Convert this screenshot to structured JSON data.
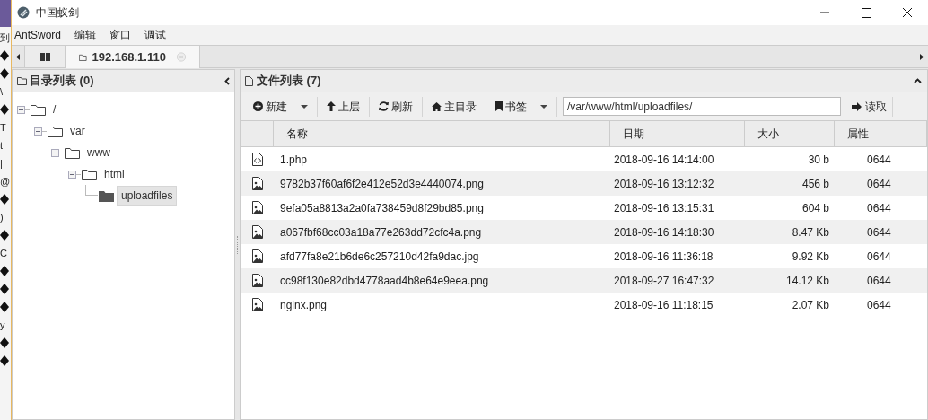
{
  "background_fragments": [
    {
      "kind": "text",
      "text": "到"
    },
    {
      "kind": "unknown_glyph"
    },
    {
      "kind": "unknown_glyph"
    },
    {
      "kind": "text",
      "text": "\\"
    },
    {
      "kind": "unknown_glyph"
    },
    {
      "kind": "text",
      "text": "T"
    },
    {
      "kind": "text",
      "text": "t"
    },
    {
      "kind": "text",
      "text": "|"
    },
    {
      "kind": "text",
      "text": "@"
    },
    {
      "kind": "unknown_glyph"
    },
    {
      "kind": "text",
      "text": ")"
    },
    {
      "kind": "unknown_glyph"
    },
    {
      "kind": "text",
      "text": "C"
    },
    {
      "kind": "unknown_glyph"
    },
    {
      "kind": "unknown_glyph"
    },
    {
      "kind": "unknown_glyph"
    },
    {
      "kind": "text",
      "text": "y"
    },
    {
      "kind": "unknown_glyph"
    },
    {
      "kind": "unknown_glyph"
    }
  ],
  "window": {
    "title": "中国蚁剑"
  },
  "menu": [
    "AntSword",
    "编辑",
    "窗口",
    "调试"
  ],
  "tabs": [
    {
      "label": "192.168.1.110",
      "selected": true
    }
  ],
  "dir_panel": {
    "title": "目录列表 (0)",
    "tree": [
      {
        "name": "/",
        "selected": false,
        "children": [
          {
            "name": "var",
            "selected": false,
            "children": [
              {
                "name": "www",
                "selected": false,
                "children": [
                  {
                    "name": "html",
                    "selected": false,
                    "children": [
                      {
                        "name": "uploadfiles",
                        "selected": true
                      }
                    ]
                  }
                ]
              }
            ]
          }
        ]
      }
    ]
  },
  "file_panel": {
    "title": "文件列表 (7)",
    "toolbar": [
      {
        "label": "新建",
        "dropdown": true
      },
      {
        "label": "上层",
        "dropdown": false
      },
      {
        "label": "刷新",
        "dropdown": false
      },
      {
        "label": "主目录",
        "dropdown": false
      },
      {
        "label": "书签",
        "dropdown": true
      }
    ],
    "path": "/var/www/html/uploadfiles/",
    "read_button": "读取",
    "columns": [
      "名称",
      "日期",
      "大小",
      "属性"
    ],
    "rows": [
      {
        "kind": "code",
        "name": "1.php",
        "date": "2018-09-16 14:14:00",
        "size": "30 b",
        "attr": "0644"
      },
      {
        "kind": "image",
        "name": "9782b37f60af6f2e412e52d3e4440074.png",
        "date": "2018-09-16 13:12:32",
        "size": "456 b",
        "attr": "0644"
      },
      {
        "kind": "image",
        "name": "9efa05a8813a2a0fa738459d8f29bd85.png",
        "date": "2018-09-16 13:15:31",
        "size": "604 b",
        "attr": "0644"
      },
      {
        "kind": "image",
        "name": "a067fbf68cc03a18a77e263dd72cfc4a.png",
        "date": "2018-09-16 14:18:30",
        "size": "8.47 Kb",
        "attr": "0644"
      },
      {
        "kind": "image",
        "name": "afd77fa8e21b6de6c257210d42fa9dac.jpg",
        "date": "2018-09-16 11:36:18",
        "size": "9.92 Kb",
        "attr": "0644"
      },
      {
        "kind": "image",
        "name": "cc98f130e82dbd4778aad4b8e64e9eea.png",
        "date": "2018-09-27 16:47:32",
        "size": "14.12 Kb",
        "attr": "0644"
      },
      {
        "kind": "image",
        "name": "nginx.png",
        "date": "2018-09-16 11:18:15",
        "size": "2.07 Kb",
        "attr": "0644"
      }
    ]
  }
}
